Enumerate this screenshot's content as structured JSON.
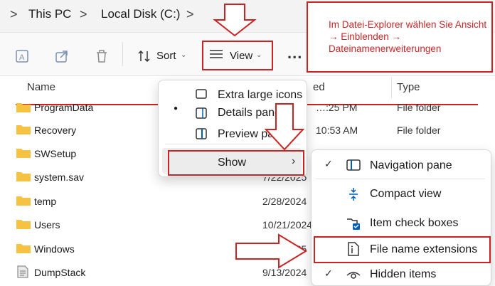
{
  "address_bar": {
    "crumbs": [
      "This PC",
      "Local Disk (C:)"
    ],
    "separator": ">"
  },
  "toolbar": {
    "sort_label": "Sort",
    "view_label": "View",
    "more_label": "...",
    "icons": [
      "rename-icon",
      "share-icon",
      "delete-icon",
      "sort-icon",
      "view-icon",
      "chevron-down-icon"
    ]
  },
  "columns": {
    "name": "Name",
    "date_fragment": "ed",
    "type": "Type"
  },
  "files": [
    {
      "name": "ProgramData",
      "date": "…:25 PM",
      "type": "File folder"
    },
    {
      "name": "Recovery",
      "date": "10:53 AM",
      "type": "File folder"
    },
    {
      "name": "SWSetup",
      "date": "",
      "type": ""
    },
    {
      "name": "system.sav",
      "date": "7/22/2025",
      "type": ""
    },
    {
      "name": "temp",
      "date": "2/28/2024",
      "type": ""
    },
    {
      "name": "Users",
      "date": "10/21/2024",
      "type": ""
    },
    {
      "name": "Windows",
      "date": "7/12/2025",
      "type": ""
    },
    {
      "name": "DumpStack",
      "date": "9/13/2024",
      "type": ""
    }
  ],
  "view_menu": {
    "items": [
      "Extra large icons",
      "Details pane",
      "Preview pane"
    ],
    "show_label": "Show"
  },
  "show_submenu": {
    "items": [
      {
        "label": "Navigation pane",
        "checked": true,
        "icon": "navigation-pane-icon"
      },
      {
        "label": "Compact view",
        "checked": false,
        "icon": "compact-view-icon"
      },
      {
        "label": "Item check boxes",
        "checked": false,
        "icon": "item-checkbox-icon"
      },
      {
        "label": "File name extensions",
        "checked": false,
        "icon": "file-extension-icon"
      },
      {
        "label": "Hidden items",
        "checked": true,
        "icon": "hidden-items-icon"
      }
    ]
  },
  "annotation": {
    "text": "Im Datei-Explorer wählen Sie Ansicht → Einblenden → Dateinamenerweiterungen",
    "color": "#cc2222"
  },
  "colors": {
    "folder": "#f5c242",
    "accent": "#005fb8",
    "annotation_red": "#cc2222"
  }
}
